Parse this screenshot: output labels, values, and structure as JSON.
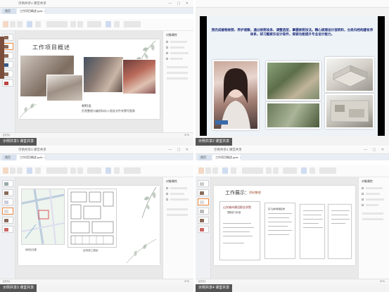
{
  "app": {
    "doc_tab_label": "工作项目概述.pptx",
    "home_tab_label": "首页"
  },
  "tiles": [
    {
      "id": "tile-1",
      "caption": "示例共享1 课堂共享",
      "slide": {
        "title": "工作项目概述",
        "caption_title": "材料员",
        "caption_text": "负责整理与编资料存入相关文件夹撰写图表"
      }
    },
    {
      "id": "tile-2",
      "caption": "示例共享2 课堂共享",
      "slide": {
        "headline": "我完成植物修剪、养护观察，通过修剪枝条、调整造型，掌握修剪技法。精心梳理设计部资料，分类归档构建有序体系，研习酷家乐设计软件，探索功能提升专业设计能力。"
      }
    },
    {
      "id": "tile-3",
      "caption": "示例共享3 课堂共享",
      "slide": {
        "plan_caption": "结构施工图纸",
        "map_caption": "地块区位图"
      }
    },
    {
      "id": "tile-4",
      "caption": "示例共享4 课堂共享",
      "slide": {
        "title": "工作展示：",
        "subtitle": "资料整理",
        "doc_title": "山东城市建设职业学院",
        "doc_subtitle": "顶岗实习计划",
        "doc2_title": "实习资料整理目录"
      }
    }
  ],
  "status": {
    "slide_label": "幻灯片",
    "zoom": "37%"
  },
  "colors": {
    "accent": "#f08a3e",
    "headline_blue": "#1a2a7a"
  },
  "props_panel_title": "对象属性"
}
